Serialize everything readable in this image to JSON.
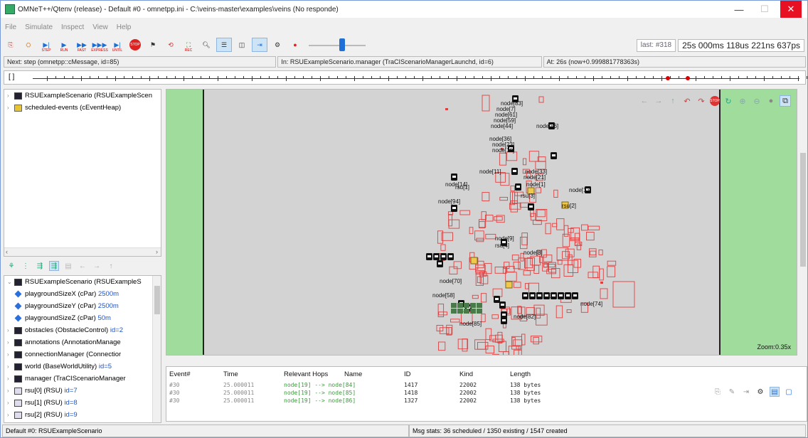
{
  "window": {
    "title": "OMNeT++/Qtenv (release) - Default #0 - omnetpp.ini - C:\\veins-master\\examples\\veins (No responde)",
    "minimize": "—",
    "maximize": "☐",
    "close": "✕"
  },
  "menu": [
    "File",
    "Simulate",
    "Inspect",
    "View",
    "Help"
  ],
  "toolbar": {
    "step_label": "STEP",
    "run_label": "RUN",
    "fast_label": "FAST",
    "express_label": "EXPRESS",
    "until_label": "UNTIL",
    "stop_label": "STOP",
    "rec_label": "REC",
    "speed_slider_level": 0.6
  },
  "time": {
    "last_event": "last: #318",
    "sim_time": "25s 000ms 118us 221ns 637ps"
  },
  "status": {
    "next": "Next: step (omnetpp::cMessage, id=85)",
    "in": "In: RSUExampleScenario.manager (TraCIScenarioManagerLaunchd, id=6)",
    "at": "At: 26s (now+0.999881778363s)"
  },
  "timeline": {
    "bracket": "[ ]"
  },
  "object_tree": [
    {
      "label": "RSUExampleScenario (RSUExampleScen",
      "icon": "network-icon"
    },
    {
      "label": "scheduled-events (cEventHeap)",
      "icon": "scheduled-events-icon"
    }
  ],
  "details_tree": {
    "root": "RSUExampleScenario (RSUExampleS",
    "params": [
      {
        "name": "playgroundSizeX (cPar)",
        "value": "2500m"
      },
      {
        "name": "playgroundSizeY (cPar)",
        "value": "2500m"
      },
      {
        "name": "playgroundSizeZ (cPar)",
        "value": "50m"
      }
    ],
    "modules": [
      {
        "name": "obstacles (ObstacleControl)",
        "id": "id=2"
      },
      {
        "name": "annotations (AnnotationManage",
        "id": ""
      },
      {
        "name": "connectionManager (Connectior",
        "id": ""
      },
      {
        "name": "world (BaseWorldUtility)",
        "id": "id=5"
      },
      {
        "name": "manager (TraCIScenarioManager",
        "id": ""
      },
      {
        "name": "rsu[0] (RSU)",
        "id": "id=7"
      },
      {
        "name": "rsu[1] (RSU)",
        "id": "id=8"
      },
      {
        "name": "rsu[2] (RSU)",
        "id": "id=9"
      }
    ]
  },
  "canvas": {
    "zoom": "Zoom:0.35x",
    "labels": [
      "node[83]",
      "node[7]",
      "node[61]",
      "node[59]",
      "node[44]",
      "node[86]",
      "node[36]",
      "node[23]",
      "node[10]",
      "node[11]",
      "node[33]",
      "node[21]",
      "node[1]",
      "node[13]",
      "node[14]",
      "rsu[1]",
      "rsu[3]",
      "rsu[2]",
      "node[94]",
      "node[9]",
      "rsu[4]",
      "node[8]",
      "node[70]",
      "node[58]",
      "node[74]",
      "node[82]",
      "node[85]"
    ]
  },
  "log": {
    "headers": [
      "Event#",
      "Time",
      "Relevant Hops",
      "Name",
      "ID",
      "Kind",
      "Length"
    ],
    "rows": [
      {
        "event": "#30",
        "time": "25.000011",
        "hops": "node[19] --> node[84]",
        "id": "1417",
        "kind": "22002",
        "length": "138 bytes"
      },
      {
        "event": "#30",
        "time": "25.000011",
        "hops": "node[19] --> node[85]",
        "id": "1418",
        "kind": "22002",
        "length": "138 bytes"
      },
      {
        "event": "#30",
        "time": "25.000011",
        "hops": "node[19] --> node[86]",
        "id": "1327",
        "kind": "22002",
        "length": "138 bytes"
      }
    ]
  },
  "bottom": {
    "config": "Default #0: RSUExampleScenario",
    "msgstats": "Msg stats: 36 scheduled / 1350 existing / 1547 created"
  }
}
